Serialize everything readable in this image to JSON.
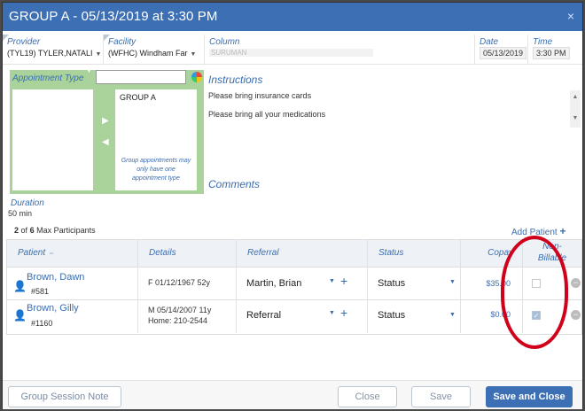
{
  "title": "GROUP A - 05/13/2019 at 3:30 PM",
  "close_icon": "×",
  "provider": {
    "label": "Provider",
    "value": "(TYL19) TYLER,NATALI"
  },
  "facility": {
    "label": "Facility",
    "value": "(WFHC) Windham Far"
  },
  "column": {
    "label": "Column",
    "value": "SURUMAN"
  },
  "date": {
    "label": "Date",
    "value": "05/13/2019"
  },
  "time": {
    "label": "Time",
    "value": "3:30 PM"
  },
  "appointment_type": {
    "label": "Appointment Type",
    "selected": "GROUP A",
    "note": "Group appointments may only have one appointment type"
  },
  "instructions": {
    "title": "Instructions",
    "lines": [
      "Please bring insurance cards",
      "Please bring all your medications"
    ]
  },
  "comments": {
    "title": "Comments"
  },
  "duration": {
    "label": "Duration",
    "value": "50 min"
  },
  "participants": {
    "count": "2",
    "of": "of",
    "max": "6",
    "suffix": "Max Participants"
  },
  "add_patient": "Add Patient",
  "table": {
    "headers": {
      "patient": "Patient",
      "details": "Details",
      "referral": "Referral",
      "status": "Status",
      "copay": "Copay",
      "non_billable_1": "Non-",
      "non_billable_2": "Billable"
    },
    "rows": [
      {
        "name": "Brown, Dawn",
        "id": "#581",
        "details1": "F  01/12/1967  52y",
        "details2": "",
        "referral": "Martin, Brian",
        "status": "Status",
        "copay": "$35.00",
        "non_billable": false
      },
      {
        "name": "Brown, Gilly",
        "id": "#1160",
        "details1": "M  05/14/2007  11y",
        "details2": "Home: 210-2544",
        "referral": "Referral",
        "status": "Status",
        "copay": "$0.00",
        "non_billable": true
      }
    ]
  },
  "buttons": {
    "group_note": "Group Session Note",
    "close": "Close",
    "save": "Save",
    "save_close": "Save and Close"
  },
  "colors": {
    "accent": "#3d6fb5",
    "annotation": "#d0021b",
    "green_panel": "#a9d39a"
  }
}
